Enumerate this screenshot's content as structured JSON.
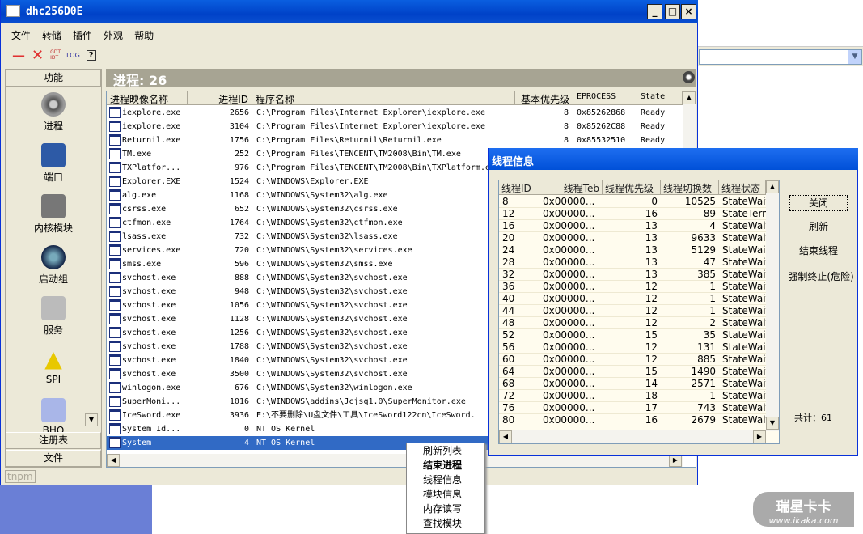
{
  "window": {
    "title": "dhc256D0E",
    "min": "_",
    "max": "□",
    "close": "×"
  },
  "menu": [
    "文件",
    "转储",
    "插件",
    "外观",
    "帮助"
  ],
  "toolbar": {
    "gdt": "GDT IDT",
    "log": "LOG",
    "help": "?"
  },
  "sidebar": {
    "header": "功能",
    "items": [
      "进程",
      "端口",
      "内核模块",
      "启动组",
      "服务",
      "SPI",
      "BHO"
    ],
    "bottom": [
      "注册表",
      "文件"
    ]
  },
  "main": {
    "header": "进程: 26",
    "columns": [
      "进程映像名称",
      "进程ID",
      "程序名称",
      "基本优先级",
      "EPROCESS",
      "State"
    ],
    "rows": [
      [
        "iexplore.exe",
        "2656",
        "C:\\Program Files\\Internet Explorer\\iexplore.exe",
        "8",
        "0x85262868",
        "Ready"
      ],
      [
        "iexplore.exe",
        "3104",
        "C:\\Program Files\\Internet Explorer\\iexplore.exe",
        "8",
        "0x85262C88",
        "Ready"
      ],
      [
        "Returnil.exe",
        "1756",
        "C:\\Program Files\\Returnil\\Returnil.exe",
        "8",
        "0x85532510",
        "Ready"
      ],
      [
        "TM.exe",
        "252",
        "C:\\Program Files\\TENCENT\\TM2008\\Bin\\TM.exe",
        "",
        "",
        ""
      ],
      [
        "TXPlatfor...",
        "976",
        "C:\\Program Files\\TENCENT\\TM2008\\Bin\\TXPlatform.e",
        "",
        "",
        ""
      ],
      [
        "Explorer.EXE",
        "1524",
        "C:\\WINDOWS\\Explorer.EXE",
        "",
        "",
        ""
      ],
      [
        "alg.exe",
        "1168",
        "C:\\WINDOWS\\System32\\alg.exe",
        "",
        "",
        ""
      ],
      [
        "csrss.exe",
        "652",
        "C:\\WINDOWS\\System32\\csrss.exe",
        "",
        "",
        ""
      ],
      [
        "ctfmon.exe",
        "1764",
        "C:\\WINDOWS\\System32\\ctfmon.exe",
        "",
        "",
        ""
      ],
      [
        "lsass.exe",
        "732",
        "C:\\WINDOWS\\System32\\lsass.exe",
        "",
        "",
        ""
      ],
      [
        "services.exe",
        "720",
        "C:\\WINDOWS\\System32\\services.exe",
        "",
        "",
        ""
      ],
      [
        "smss.exe",
        "596",
        "C:\\WINDOWS\\System32\\smss.exe",
        "",
        "",
        ""
      ],
      [
        "svchost.exe",
        "888",
        "C:\\WINDOWS\\System32\\svchost.exe",
        "",
        "",
        ""
      ],
      [
        "svchost.exe",
        "948",
        "C:\\WINDOWS\\System32\\svchost.exe",
        "",
        "",
        ""
      ],
      [
        "svchost.exe",
        "1056",
        "C:\\WINDOWS\\System32\\svchost.exe",
        "",
        "",
        ""
      ],
      [
        "svchost.exe",
        "1128",
        "C:\\WINDOWS\\System32\\svchost.exe",
        "",
        "",
        ""
      ],
      [
        "svchost.exe",
        "1256",
        "C:\\WINDOWS\\System32\\svchost.exe",
        "",
        "",
        ""
      ],
      [
        "svchost.exe",
        "1788",
        "C:\\WINDOWS\\System32\\svchost.exe",
        "",
        "",
        ""
      ],
      [
        "svchost.exe",
        "1840",
        "C:\\WINDOWS\\System32\\svchost.exe",
        "",
        "",
        ""
      ],
      [
        "svchost.exe",
        "3500",
        "C:\\WINDOWS\\System32\\svchost.exe",
        "",
        "",
        ""
      ],
      [
        "winlogon.exe",
        "676",
        "C:\\WINDOWS\\System32\\winlogon.exe",
        "",
        "",
        ""
      ],
      [
        "SuperMoni...",
        "1016",
        "C:\\WINDOWS\\addins\\Jcjsq1.0\\SuperMonitor.exe",
        "",
        "",
        ""
      ],
      [
        "IceSword.exe",
        "3936",
        "E:\\不要删除\\U盘文件\\工具\\IceSword122cn\\IceSword.",
        "",
        "",
        ""
      ],
      [
        "System Id...",
        "0",
        "NT OS Kernel",
        "",
        "",
        ""
      ],
      [
        "System",
        "4",
        "NT OS Kernel",
        "",
        "",
        ""
      ]
    ],
    "selected_index": 24
  },
  "status": "tnpm",
  "dialog": {
    "title": "线程信息",
    "columns": [
      "线程ID",
      "线程Teb",
      "线程优先级",
      "线程切换数",
      "线程状态"
    ],
    "rows": [
      [
        "8",
        "0x00000...",
        "0",
        "10525",
        "StateWait"
      ],
      [
        "12",
        "0x00000...",
        "16",
        "89",
        "StateTerm"
      ],
      [
        "16",
        "0x00000...",
        "13",
        "4",
        "StateWait"
      ],
      [
        "20",
        "0x00000...",
        "13",
        "9633",
        "StateWait"
      ],
      [
        "24",
        "0x00000...",
        "13",
        "5129",
        "StateWait"
      ],
      [
        "28",
        "0x00000...",
        "13",
        "47",
        "StateWait"
      ],
      [
        "32",
        "0x00000...",
        "13",
        "385",
        "StateWait"
      ],
      [
        "36",
        "0x00000...",
        "12",
        "1",
        "StateWait"
      ],
      [
        "40",
        "0x00000...",
        "12",
        "1",
        "StateWait"
      ],
      [
        "44",
        "0x00000...",
        "12",
        "1",
        "StateWait"
      ],
      [
        "48",
        "0x00000...",
        "12",
        "2",
        "StateWait"
      ],
      [
        "52",
        "0x00000...",
        "15",
        "35",
        "StateWait"
      ],
      [
        "56",
        "0x00000...",
        "12",
        "131",
        "StateWait"
      ],
      [
        "60",
        "0x00000...",
        "12",
        "885",
        "StateWait"
      ],
      [
        "64",
        "0x00000...",
        "15",
        "1490",
        "StateWait"
      ],
      [
        "68",
        "0x00000...",
        "14",
        "2571",
        "StateWait"
      ],
      [
        "72",
        "0x00000...",
        "18",
        "1",
        "StateWait"
      ],
      [
        "76",
        "0x00000...",
        "17",
        "743",
        "StateWait"
      ],
      [
        "80",
        "0x00000...",
        "16",
        "2679",
        "StateWait"
      ]
    ],
    "buttons": [
      "关闭",
      "刷新",
      "结束线程",
      "强制终止(危险)"
    ],
    "total": "共计：61"
  },
  "context_menu": [
    "刷新列表",
    "结束进程",
    "线程信息",
    "模块信息",
    "内存读写",
    "查找模块"
  ],
  "watermark": {
    "brand": "瑞星卡卡",
    "url": "www.ikaka.com"
  }
}
